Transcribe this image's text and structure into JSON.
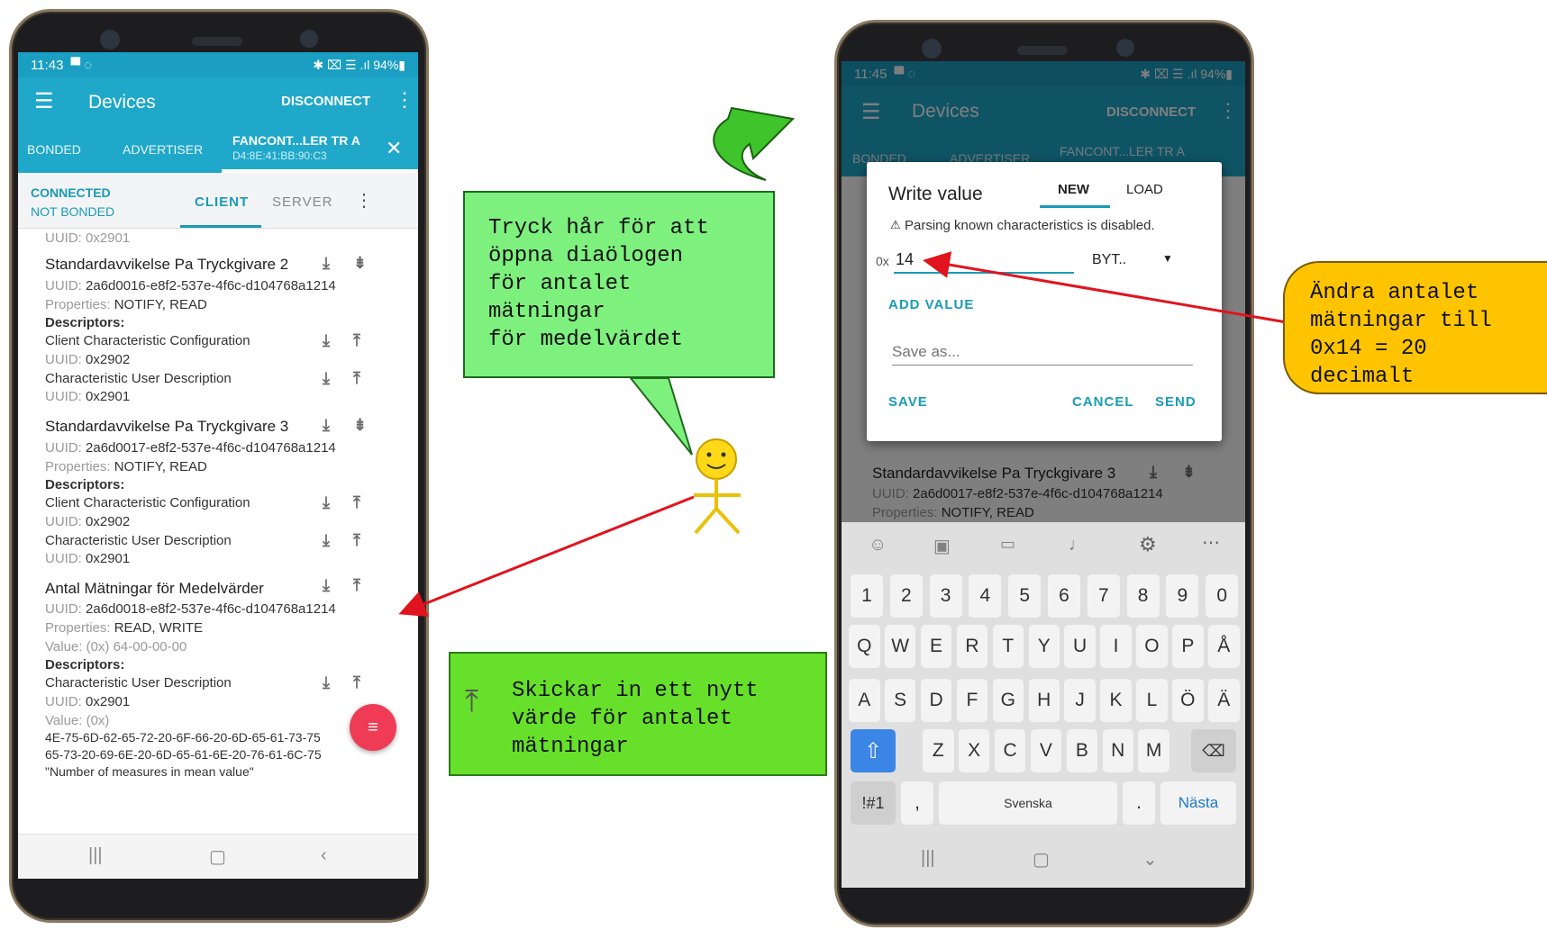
{
  "left_phone": {
    "status": {
      "time": "11:43",
      "right": "✱ ⌧ ☰ .ıl 94%▮"
    },
    "appbar": {
      "title": "Devices",
      "disconnect": "DISCONNECT"
    },
    "tabs": [
      "BONDED",
      "ADVERTISER"
    ],
    "device_tab": {
      "name": "FANCONT...LER TR A",
      "mac": "D4:8E:41:BB:90:C3"
    },
    "connection": {
      "connected": "CONNECTED",
      "bond": "NOT BONDED",
      "client": "CLIENT",
      "server": "SERVER"
    },
    "top_uuid": "UUID: 0x2901",
    "char2": {
      "name": "Standardavvikelse Pa Tryckgivare 2",
      "uuid_label": "UUID:",
      "uuid": "2a6d0016-e8f2-537e-4f6c-d104768a1214",
      "props_label": "Properties:",
      "props": "NOTIFY, READ",
      "descriptors": "Descriptors:",
      "d1": "Client Characteristic Configuration",
      "d1_uuid_label": "UUID:",
      "d1_uuid": "0x2902",
      "d2": "Characteristic User Description",
      "d2_uuid_label": "UUID:",
      "d2_uuid": "0x2901"
    },
    "char3": {
      "name": "Standardavvikelse Pa Tryckgivare 3",
      "uuid_label": "UUID:",
      "uuid": "2a6d0017-e8f2-537e-4f6c-d104768a1214",
      "props_label": "Properties:",
      "props": "NOTIFY, READ",
      "descriptors": "Descriptors:",
      "d1": "Client Characteristic Configuration",
      "d1_uuid_label": "UUID:",
      "d1_uuid": "0x2902",
      "d2": "Characteristic User Description",
      "d2_uuid_label": "UUID:",
      "d2_uuid": "0x2901"
    },
    "char4": {
      "name": "Antal Mätningar för Medelvärder",
      "uuid_label": "UUID:",
      "uuid": "2a6d0018-e8f2-537e-4f6c-d104768a1214",
      "props_label": "Properties:",
      "props": "READ, WRITE",
      "value_label": "Value:",
      "value": "(0x) 64-00-00-00",
      "descriptors": "Descriptors:",
      "d1": "Characteristic User Description",
      "d1_uuid_label": "UUID:",
      "d1_uuid": "0x2901",
      "d1_value_label": "Value:",
      "d1_value": "(0x)",
      "hex1": "4E-75-6D-62-65-72-20-6F-66-20-6D-65-61-73-75",
      "hex2": "65-73-20-69-6E-20-6D-65-61-6E-20-76-61-6C-75",
      "quote": "\"Number of measures in mean value\""
    }
  },
  "right_phone": {
    "status": {
      "time": "11:45",
      "right": "✱ ⌧ ☰ .ıl 94%▮"
    },
    "appbar": {
      "title": "Devices",
      "disconnect": "DISCONNECT"
    },
    "tab_peek": {
      "bonded": "BONDED",
      "advertiser": "ADVERTISER",
      "device": "FANCONT...LER TR A"
    },
    "dialog": {
      "title": "Write value",
      "tab_new": "NEW",
      "tab_load": "LOAD",
      "warning": "Parsing known characteristics is disabled.",
      "prefix": "0x",
      "value": "14",
      "type": "BYT..",
      "add_value": "ADD VALUE",
      "save_as_placeholder": "Save as...",
      "save": "SAVE",
      "cancel": "CANCEL",
      "send": "SEND"
    },
    "below_dialog": {
      "name": "Standardavvikelse Pa Tryckgivare 3",
      "uuid_label": "UUID:",
      "uuid": "2a6d0017-e8f2-537e-4f6c-d104768a1214",
      "props_label": "Properties:",
      "props": "NOTIFY, READ"
    },
    "keyboard": {
      "row1": [
        "1",
        "2",
        "3",
        "4",
        "5",
        "6",
        "7",
        "8",
        "9",
        "0"
      ],
      "row2": [
        "Q",
        "W",
        "E",
        "R",
        "T",
        "Y",
        "U",
        "I",
        "O",
        "P",
        "Å"
      ],
      "row3": [
        "A",
        "S",
        "D",
        "F",
        "G",
        "H",
        "J",
        "K",
        "L",
        "Ö",
        "Ä"
      ],
      "row4": [
        "Z",
        "X",
        "C",
        "V",
        "B",
        "N",
        "M"
      ],
      "sym": "!#1",
      "comma": ",",
      "space": "Svenska",
      "period": ".",
      "next": "Nästa"
    }
  },
  "annotations": {
    "bubble1": [
      "Tryck hår för att",
      "öppna diaölogen",
      "för antalet",
      "mätningar",
      "för medelvärdet"
    ],
    "bubble2": [
      "Skickar in ett nytt",
      "värde för antalet",
      "mätningar"
    ],
    "bubble3": [
      "Ändra antalet",
      "mätningar till",
      "0x14 = 20",
      "decimalt"
    ],
    "colors": {
      "green_light": "#7ef07e",
      "green": "#66e02a",
      "yellow": "#ffc400",
      "arrow_red": "#e0141e",
      "arrow_green": "#3fc42c"
    }
  }
}
